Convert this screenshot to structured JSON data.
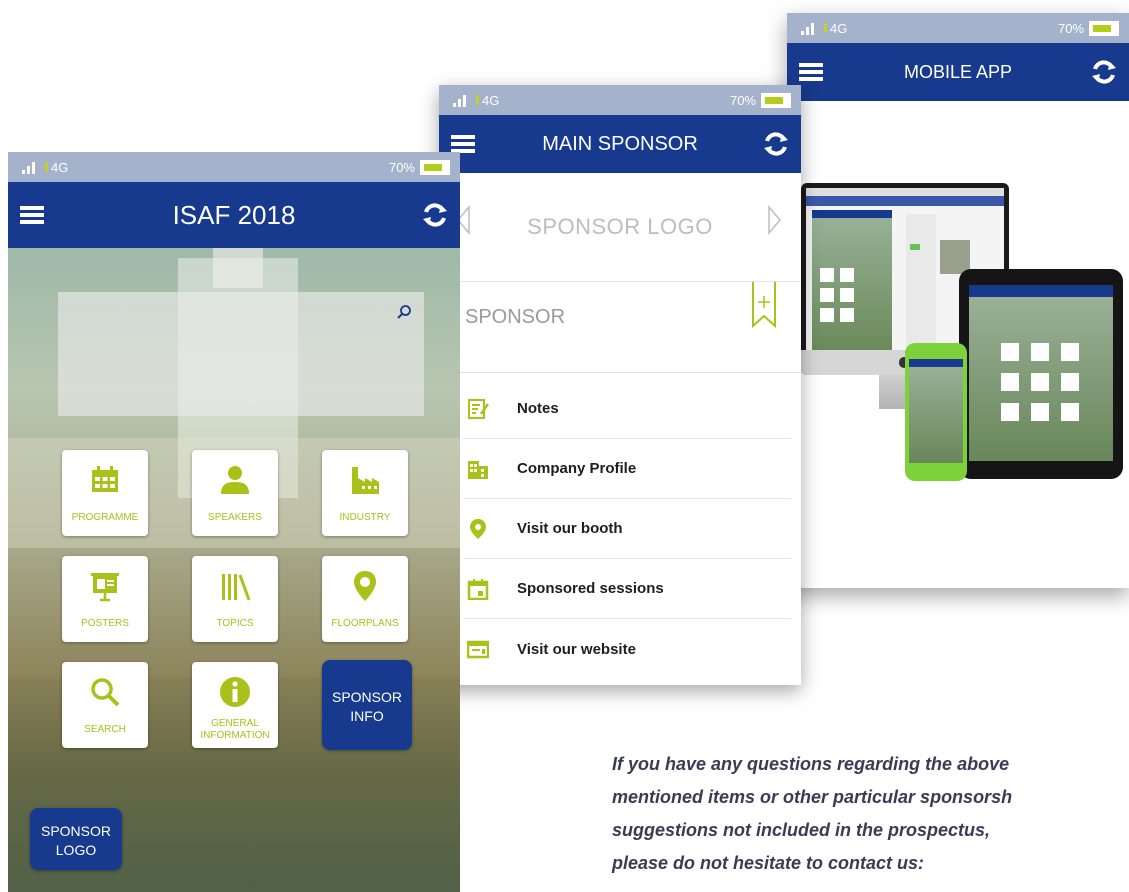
{
  "status_bar": {
    "network": "4G",
    "battery": "70%"
  },
  "screen_home": {
    "title": "ISAF 2018",
    "tiles": [
      {
        "label": "PROGRAMME",
        "icon": "calendar-icon"
      },
      {
        "label": "SPEAKERS",
        "icon": "person-icon"
      },
      {
        "label": "INDUSTRY",
        "icon": "factory-icon"
      },
      {
        "label": "POSTERS",
        "icon": "presentation-icon"
      },
      {
        "label": "TOPICS",
        "icon": "books-icon"
      },
      {
        "label": "FLOORPLANS",
        "icon": "map-pin-icon"
      },
      {
        "label": "SEARCH",
        "icon": "search-icon"
      },
      {
        "label": "GENERAL INFORMATION",
        "icon": "info-icon"
      }
    ],
    "sponsor_info": [
      "SPONSOR",
      "INFO"
    ],
    "sponsor_logo": [
      "SPONSOR",
      "LOGO"
    ]
  },
  "screen_sponsor": {
    "title": "MAIN SPONSOR",
    "logo_placeholder": "SPONSOR LOGO",
    "sponsor_name": "SPONSOR",
    "menu": [
      {
        "label": "Notes",
        "icon": "notes-icon"
      },
      {
        "label": "Company Profile",
        "icon": "building-icon"
      },
      {
        "label": "Visit our booth",
        "icon": "map-pin-icon"
      },
      {
        "label": "Sponsored sessions",
        "icon": "calendar-icon"
      },
      {
        "label": "Visit our website",
        "icon": "website-icon"
      }
    ]
  },
  "screen_app": {
    "title": "MOBILE APP"
  },
  "contact_text": [
    "If you have any questions regarding the above",
    "mentioned items or other particular sponsorsh",
    "suggestions not included in the prospectus,",
    "please do not hesitate to contact us:"
  ],
  "colors": {
    "brand_blue": "#173a8e",
    "accent_green": "#a9c21a",
    "status_bar": "#a5b2cb"
  }
}
